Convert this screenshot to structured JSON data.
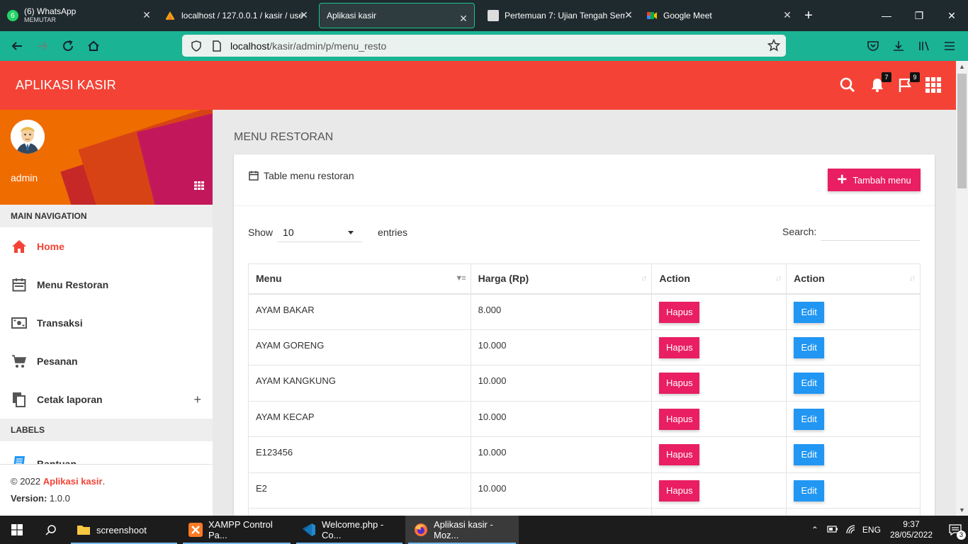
{
  "browser": {
    "tabs": [
      {
        "title": "(6) WhatsApp",
        "subtitle": "MEMUTAR",
        "badge": "6"
      },
      {
        "title": "localhost / 127.0.0.1 / kasir / use"
      },
      {
        "title": "Aplikasi kasir"
      },
      {
        "title": "Pertemuan 7: Ujian Tengah Sem"
      },
      {
        "title": "Google Meet"
      }
    ],
    "url_host": "localhost",
    "url_path": "/kasir/admin/p/menu_resto"
  },
  "app": {
    "brand": "APLIKASI KASIR",
    "notifications_count": "7",
    "tasks_count": "9"
  },
  "sidebar": {
    "user_name": "admin",
    "main_nav_header": "MAIN NAVIGATION",
    "items": [
      {
        "label": "Home",
        "icon": "home-icon"
      },
      {
        "label": "Menu Restoran",
        "icon": "calendar-icon"
      },
      {
        "label": "Transaksi",
        "icon": "money-icon"
      },
      {
        "label": "Pesanan",
        "icon": "cart-icon"
      },
      {
        "label": "Cetak laporan",
        "icon": "copy-icon"
      }
    ],
    "labels_header": "LABELS",
    "label_items": [
      {
        "label": "Bantuan"
      }
    ],
    "footer_copyright": "© 2022 ",
    "footer_brand": "Aplikasi kasir",
    "footer_dot": ".",
    "footer_version_label": "Version:",
    "footer_version": " 1.0.0"
  },
  "content": {
    "page_title": "MENU RESTORAN",
    "card_title": "Table menu restoran",
    "add_button": "Tambah menu",
    "show_label": "Show",
    "entries_value": "10",
    "entries_label": "entries",
    "search_label": "Search:",
    "table": {
      "headers": [
        "Menu",
        "Harga (Rp)",
        "Action",
        "Action"
      ],
      "hapus_label": "Hapus",
      "edit_label": "Edit",
      "rows": [
        {
          "menu": "AYAM BAKAR",
          "harga": "8.000"
        },
        {
          "menu": "AYAM GORENG",
          "harga": "10.000"
        },
        {
          "menu": "AYAM KANGKUNG",
          "harga": "10.000"
        },
        {
          "menu": "AYAM KECAP",
          "harga": "10.000"
        },
        {
          "menu": "E123456",
          "harga": "10.000"
        },
        {
          "menu": "E2",
          "harga": "10.000"
        }
      ]
    }
  },
  "taskbar": {
    "items": [
      {
        "label": "screenshoot"
      },
      {
        "label": "XAMPP Control Pa..."
      },
      {
        "label": "Welcome.php - Co..."
      },
      {
        "label": "Aplikasi kasir - Moz..."
      }
    ],
    "lang": "ENG",
    "time": "9:37",
    "date": "28/05/2022",
    "notif_count": "3"
  },
  "colors": {
    "primary": "#f44336",
    "pink": "#e91e63",
    "blue": "#2196f3",
    "browser_toolbar": "#1ab394"
  }
}
